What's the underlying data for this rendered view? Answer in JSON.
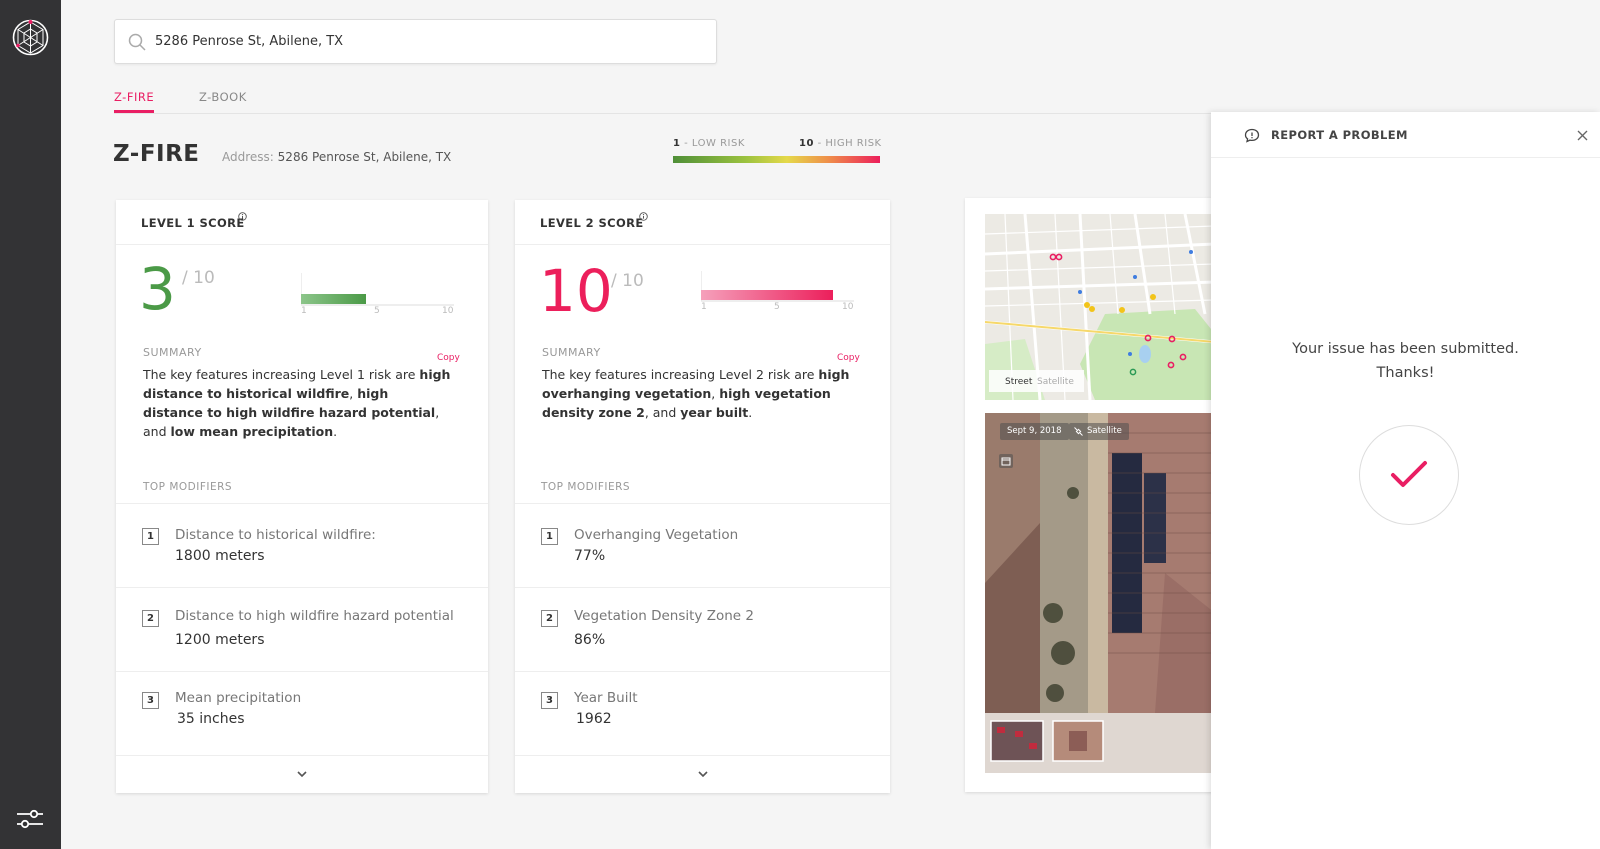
{
  "search": {
    "value": "5286 Penrose St, Abilene, TX"
  },
  "tabs": [
    {
      "label": "Z-FIRE",
      "active": true
    },
    {
      "label": "Z-BOOK",
      "active": false
    }
  ],
  "page": {
    "title": "Z-FIRE",
    "address_label": "Address:",
    "address_value": "5286 Penrose St, Abilene, TX"
  },
  "legend": {
    "low_num": "1",
    "low_text": " - LOW RISK",
    "high_num": "10",
    "high_text": " - HIGH RISK"
  },
  "level1": {
    "title": "LEVEL 1 SCORE",
    "score": "3",
    "out_of": "/ 10",
    "fill": 0.3,
    "ticks": [
      "1",
      "5",
      "10"
    ],
    "summary_label": "SUMMARY",
    "copy_label": "Copy",
    "summary": {
      "p1": "The key features increasing Level 1 risk are ",
      "b1": "high distance to historical wildfire",
      "p2": ", ",
      "b2": "high distance to high wildfire hazard potential",
      "p3": ", and ",
      "b3": "low mean precipitation",
      "p4": "."
    },
    "modifiers_label": "TOP MODIFIERS",
    "modifiers": [
      {
        "num": "1",
        "name": "Distance to historical wildfire:",
        "value": "1800 meters"
      },
      {
        "num": "2",
        "name": "Distance to high wildfire hazard potential",
        "value": "1200 meters"
      },
      {
        "num": "3",
        "name": "Mean precipitation",
        "value": "35 inches"
      }
    ]
  },
  "level2": {
    "title": "LEVEL 2 SCORE",
    "score": "10",
    "out_of": "/ 10",
    "fill": 1.0,
    "ticks": [
      "1",
      "5",
      "10"
    ],
    "summary_label": "SUMMARY",
    "copy_label": "Copy",
    "summary": {
      "p1": "The key features increasing Level 2 risk are ",
      "b1": "high overhanging vegetation",
      "p2": ", ",
      "b2": "high vegetation density zone 2",
      "p3": ", and ",
      "b3": "year built",
      "p4": "."
    },
    "modifiers_label": "TOP MODIFIERS",
    "modifiers": [
      {
        "num": "1",
        "name": "Overhanging Vegetation",
        "value": "77%"
      },
      {
        "num": "2",
        "name": "Vegetation Density Zone 2",
        "value": "86%"
      },
      {
        "num": "3",
        "name": "Year Built",
        "value": "1962"
      }
    ]
  },
  "imagery": {
    "map_street": "Street",
    "map_satellite": "Satellite",
    "sat_date": "Sept 9, 2018",
    "sat_mode": "Satellite"
  },
  "report": {
    "title": "REPORT A PROBLEM",
    "message_line1": "Your issue has been submitted.",
    "message_line2": "Thanks!"
  },
  "colors": {
    "accent": "#e91e63",
    "low_score": "#4b9a47",
    "high_score": "#ec1f5b",
    "rail": "#333335"
  },
  "icons": [
    "logo-icon",
    "search-icon",
    "info-icon",
    "chevron-down-icon",
    "calendar-icon",
    "satellite-icon",
    "chat-alert-icon",
    "close-icon",
    "check-icon",
    "sliders-icon"
  ]
}
